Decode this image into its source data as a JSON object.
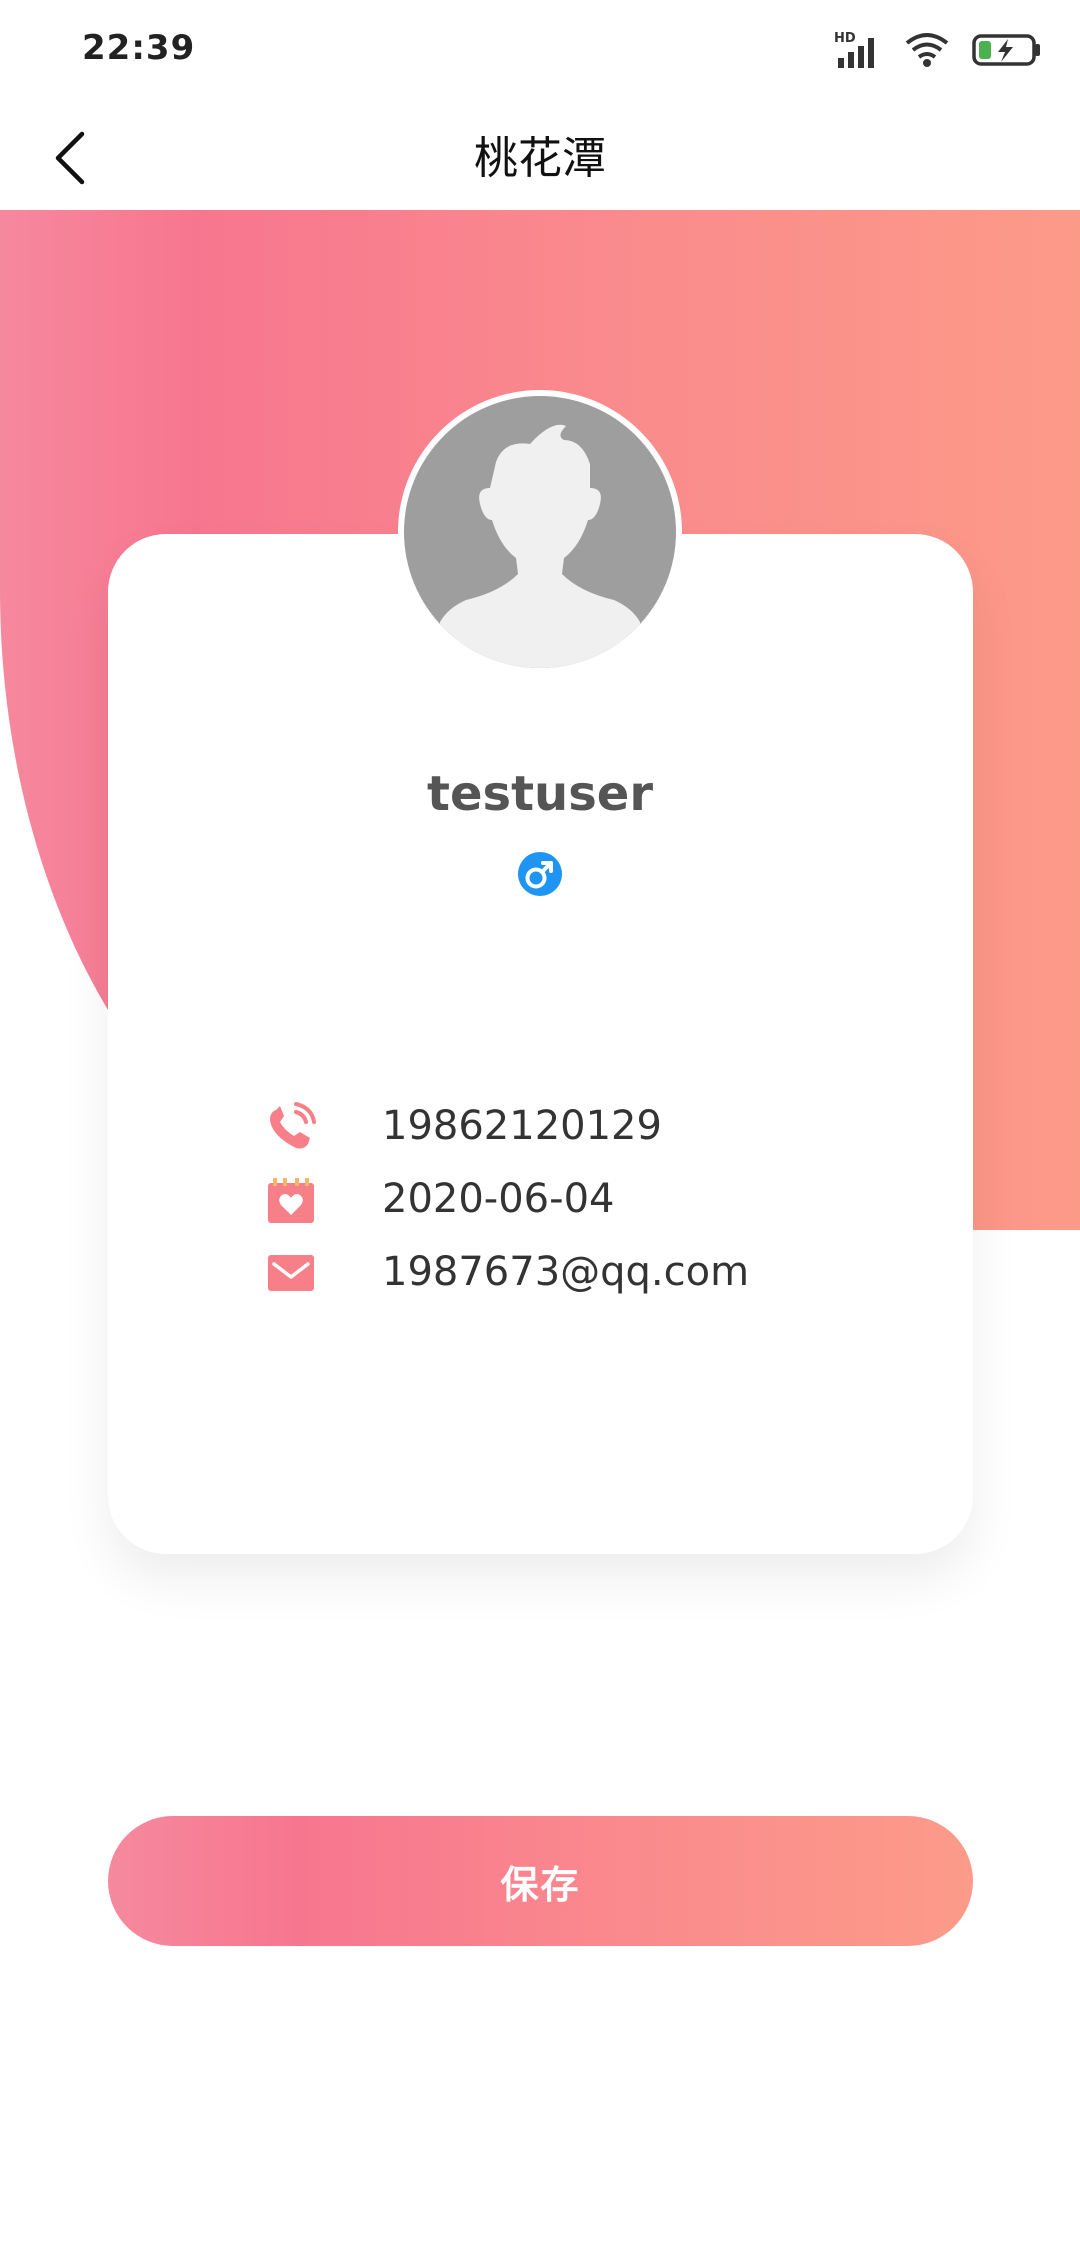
{
  "status_bar": {
    "time": "22:39",
    "network_badge": "HD"
  },
  "nav": {
    "title": "桃花潭",
    "back_icon": "chevron-left-icon"
  },
  "profile": {
    "username": "testuser",
    "gender_icon": "male-icon",
    "avatar_icon": "default-avatar-icon"
  },
  "info": {
    "phone": "19862120129",
    "birthday": "2020-06-04",
    "email": "1987673@qq.com"
  },
  "actions": {
    "save_label": "保存"
  },
  "colors": {
    "accent": "#F7768F",
    "gradient_end": "#FC9A88",
    "gender_male": "#1E95F2",
    "icon_pink": "#F77F88"
  }
}
